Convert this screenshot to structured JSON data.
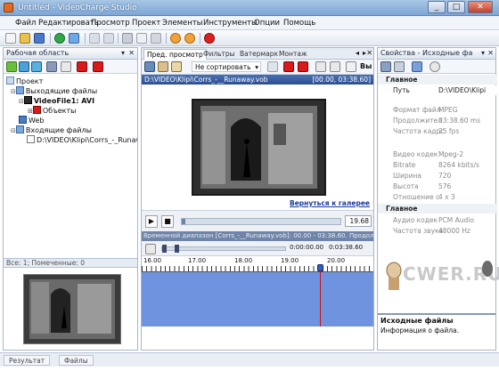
{
  "window": {
    "title": "Untitled - VideoCharge Studio",
    "min": "_",
    "max": "□",
    "close": "✕"
  },
  "menu": [
    "Файл",
    "Редактировать",
    "Просмотр",
    "Проект",
    "Элементы",
    "Инструменты",
    "Опции",
    "Помощь"
  ],
  "workspace": {
    "title": "Рабочая область",
    "tree": {
      "project": "Проект",
      "outgoing": "Выходящие файлы",
      "videofile": "VideoFile1: AVI",
      "objects": "Объекты",
      "web": "Web",
      "incoming": "Входящие файлы",
      "incoming_file": "D:\\VIDEO\\Klipi\\Corrs_-_Runawa"
    },
    "footer": "Все: 1; Помеченные: 0"
  },
  "center": {
    "tabs": [
      "Пред. просмотр",
      "Фильтры",
      "Ватермарк",
      "Монтаж"
    ],
    "sort_label": "Не сортировать",
    "filepath": "D:\\VIDEO\\Klipi\\Corrs_-__Runaway.vob",
    "time_range": "[00.00, 03:38.60]",
    "gallery_link": "Вернуться к галерее",
    "player_time": "19.68",
    "range_text": "Временной диапазон [Corrs_-__Runaway.vob]: 00.00 - 03:38.60. Продолжительн",
    "start_time": "0:00:00.00",
    "end_time": "0:03:38.60",
    "ruler": [
      "16.00",
      "17.00",
      "18.00",
      "19.00",
      "20.00"
    ]
  },
  "properties": {
    "title": "Свойства - Исходные фа",
    "categories": {
      "main1": "Главное",
      "main2": "Главное"
    },
    "rows": [
      {
        "k": "Путь",
        "v": "D:\\VIDEO\\Klipi",
        "bold": true
      },
      {
        "k": "Формат файл",
        "v": "MPEG"
      },
      {
        "k": "Продолжител",
        "v": "03:38.60 ms"
      },
      {
        "k": "Частота кадрс",
        "v": "25 fps"
      },
      {
        "k": "Видео кодек",
        "v": "Mpeg-2"
      },
      {
        "k": "Bitrate",
        "v": "8264 kbits/s"
      },
      {
        "k": "Ширина",
        "v": "720"
      },
      {
        "k": "Высота",
        "v": "576"
      },
      {
        "k": "Отношение с",
        "v": "4 x 3"
      },
      {
        "k": "Аудио кодек",
        "v": "PCM Audio"
      },
      {
        "k": "Частота звука",
        "v": "48000 Hz"
      }
    ],
    "watermark": "CWER.RU",
    "info_title": "Исходные файлы",
    "info_text": "Информация о файла."
  },
  "status": [
    "Результат",
    "Файлы"
  ],
  "colors": {
    "accent": "#2e4f92",
    "timeline": "#6f93de",
    "playhead": "#d01010"
  }
}
